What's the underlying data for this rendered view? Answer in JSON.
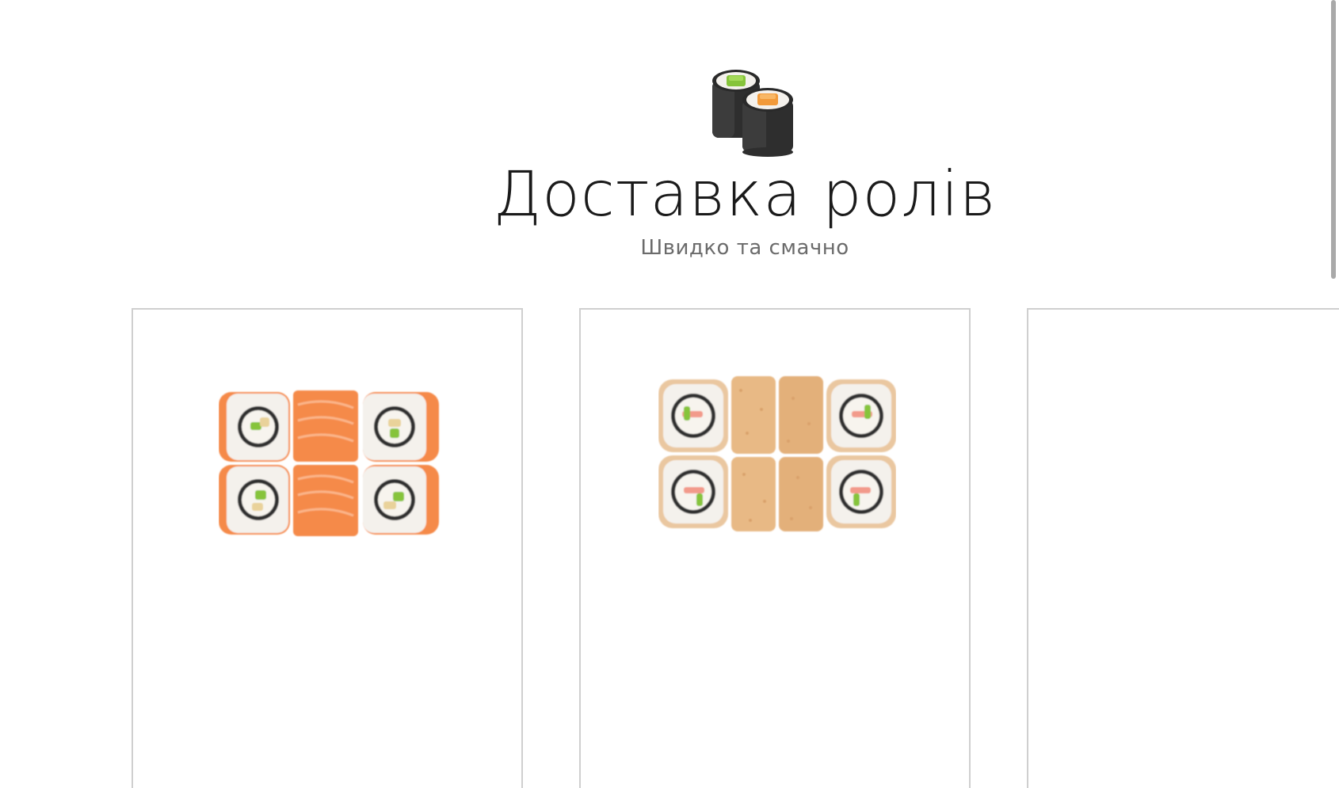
{
  "header": {
    "logo_icon": "sushi-rolls-icon",
    "title": "Доставка ролів",
    "subtitle": "Швидко та смачно"
  },
  "products": [
    {
      "image_icon": "salmon-roll-set-image"
    },
    {
      "image_icon": "tempura-roll-set-image"
    },
    {
      "image_icon": ""
    }
  ],
  "colors": {
    "salmon": "#f58a4a",
    "tempura": "#e8b985",
    "rice": "#f4f1ec",
    "nori": "#2e2e2e",
    "green_topping": "#86c43a",
    "orange_topping": "#f29a3a",
    "card_border": "#cfcfcf"
  }
}
